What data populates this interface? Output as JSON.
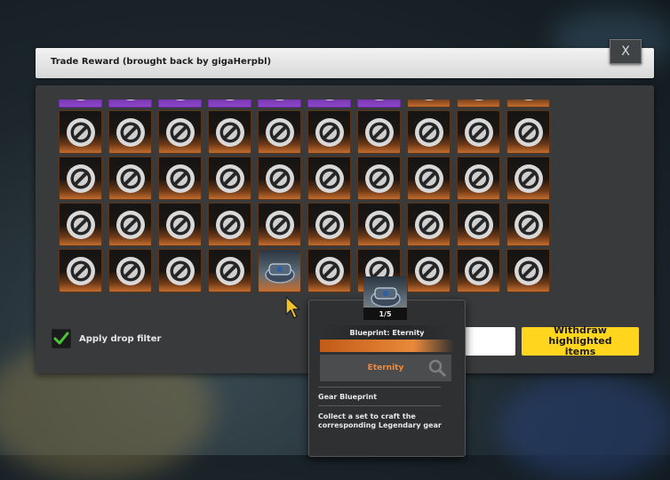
{
  "header": {
    "title": "Trade Reward (brought back by gigaHerpbl)"
  },
  "close_button": {
    "label": "X"
  },
  "grid": {
    "columns": 10,
    "rows": [
      [
        "purple",
        "purple",
        "purple",
        "purple",
        "purple",
        "purple",
        "purple",
        "empty",
        "empty",
        "empty"
      ],
      [
        "empty",
        "empty",
        "empty",
        "empty",
        "empty",
        "empty",
        "empty",
        "empty",
        "empty",
        "empty"
      ],
      [
        "empty",
        "empty",
        "empty",
        "empty",
        "empty",
        "empty",
        "empty",
        "empty",
        "empty",
        "empty"
      ],
      [
        "empty",
        "empty",
        "empty",
        "empty",
        "empty",
        "empty",
        "empty",
        "empty",
        "empty",
        "empty"
      ],
      [
        "empty",
        "empty",
        "empty",
        "empty",
        "item",
        "empty",
        "empty",
        "empty",
        "empty",
        "empty"
      ]
    ],
    "empty_icon": "no-entry-icon",
    "item_icon": "gear-blueprint-icon"
  },
  "filter": {
    "label": "Apply drop filter",
    "checked": true
  },
  "buttons": {
    "withdraw_label": "Withdraw highlighted items"
  },
  "tooltip": {
    "count": "1/5",
    "title": "Blueprint: Eternity",
    "rarity_label": "Eternity",
    "item_type": "Gear Blueprint",
    "description": "Collect a set to craft the corresponding Legendary gear"
  },
  "colors": {
    "accent_yellow": "#ffd51e",
    "legendary_orange": "#f08b3c",
    "epic_purple": "#8c46c8",
    "check_green": "#4cc23a"
  }
}
